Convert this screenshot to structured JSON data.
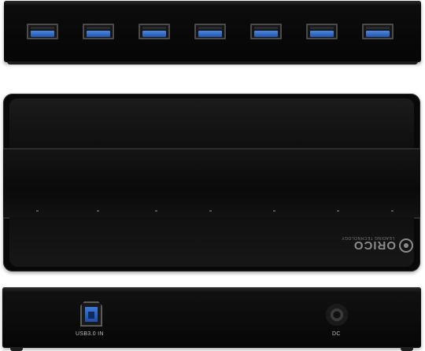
{
  "product": {
    "brand": "ORICO",
    "tagline": "LEADING TECHNOLOGY"
  },
  "views": {
    "front": {
      "usb_ports": 7
    },
    "top": {
      "indicator_leds": 7
    },
    "back": {
      "input_label": "USB3.0 IN",
      "power_label": "DC"
    }
  },
  "colors": {
    "body": "#080808",
    "usb3_blue": "#3a72d0",
    "label": "#bdbdbd"
  },
  "icons": {
    "brand_logo": "orico-logo-icon",
    "usb_port": "usb-a-port-icon",
    "usb_b_port": "usb-b-port-icon",
    "dc_jack": "dc-jack-icon"
  }
}
